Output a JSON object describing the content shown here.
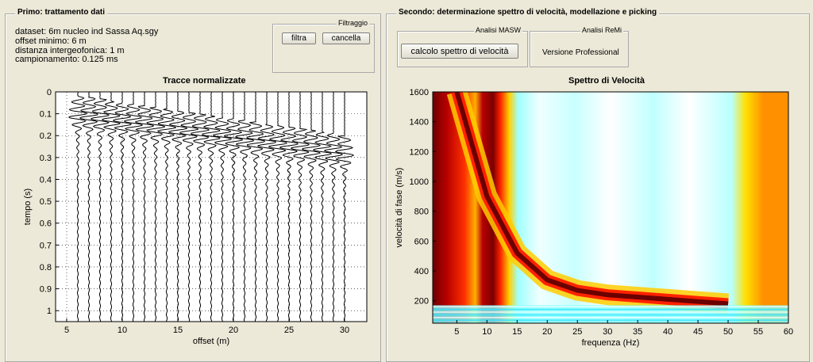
{
  "left_panel": {
    "title": "Primo: trattamento dati",
    "info": [
      "dataset: 6m nucleo ind Sassa Aq.sgy",
      "offset minimo: 6 m",
      "distanza intergeofonica: 1 m",
      "campionamento: 0.125 ms"
    ],
    "filter_box": {
      "title": "Filtraggio",
      "filter_label": "filtra",
      "cancel_label": "cancella"
    }
  },
  "right_panel": {
    "title": "Secondo: determinazione spettro di velocità, modellazione e picking",
    "masw": {
      "title": "Analisi MASW",
      "button_label": "calcolo spettro di velocità"
    },
    "remi": {
      "title": "Analisi ReMi",
      "text": "Versione Professional"
    }
  },
  "colors": {
    "background": "#ece9d8",
    "trace": "#000000",
    "spectrum_hot": "#8b0000",
    "spectrum_cold": "#e8ffff"
  },
  "chart_data": [
    {
      "type": "line",
      "title": "Tracce normalizzate",
      "xlabel": "offset (m)",
      "ylabel": "tempo (s)",
      "xlim": [
        4,
        32
      ],
      "ylim": [
        1.05,
        0
      ],
      "x_ticks": [
        5,
        10,
        15,
        20,
        25,
        30
      ],
      "y_ticks": [
        0,
        0.1,
        0.2,
        0.3,
        0.4,
        0.5,
        0.6,
        0.7,
        0.8,
        0.9,
        1
      ],
      "grid": true,
      "trace_offsets": [
        6,
        7,
        8,
        9,
        10,
        11,
        12,
        13,
        14,
        15,
        16,
        17,
        18,
        19,
        20,
        21,
        22,
        23,
        24,
        25,
        26,
        27,
        28,
        29,
        30
      ]
    },
    {
      "type": "heatmap",
      "title": "Spettro di Velocità",
      "xlabel": "frequenza (Hz)",
      "ylabel": "velocità di fase (m/s)",
      "xlim": [
        1,
        60
      ],
      "ylim": [
        50,
        1600
      ],
      "x_ticks": [
        5,
        10,
        15,
        20,
        25,
        30,
        35,
        40,
        45,
        50,
        55,
        60
      ],
      "y_ticks": [
        200,
        400,
        600,
        800,
        1000,
        1200,
        1400,
        1600
      ],
      "colormap": "jet-like (dark red high, cyan/white low)",
      "dispersion_curve": {
        "frequency": [
          5,
          10,
          15,
          20,
          25,
          30,
          35,
          40,
          45,
          50
        ],
        "velocity": [
          1600,
          900,
          520,
          340,
          270,
          240,
          225,
          210,
          195,
          180
        ]
      }
    }
  ]
}
